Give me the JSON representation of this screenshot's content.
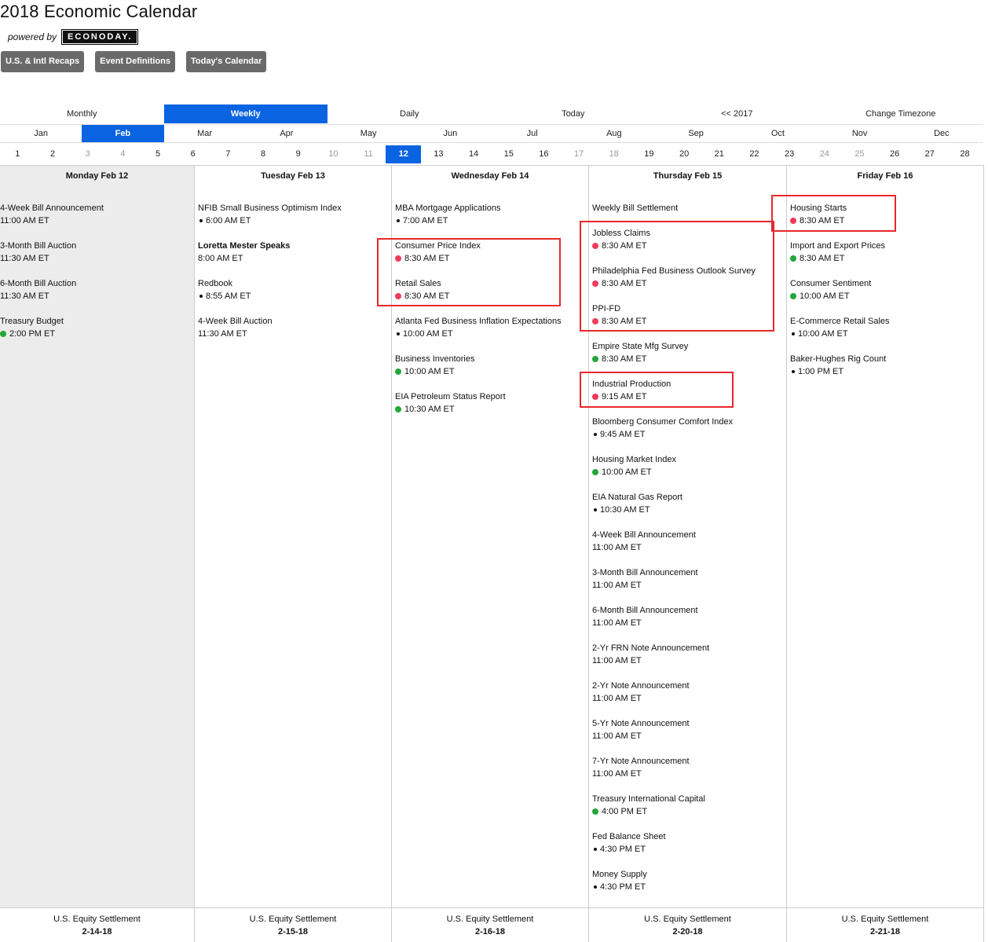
{
  "header": {
    "title": "2018 Economic Calendar",
    "powered_by": "powered by",
    "logo_text": "ECONODAY."
  },
  "buttons": [
    "U.S. & Intl Recaps",
    "Event Definitions",
    "Today's Calendar"
  ],
  "views": [
    "Monthly",
    "Weekly",
    "Daily",
    "Today",
    "<< 2017",
    "Change Timezone"
  ],
  "active_view": "Weekly",
  "months": [
    "Jan",
    "Feb",
    "Mar",
    "Apr",
    "May",
    "Jun",
    "Jul",
    "Aug",
    "Sep",
    "Oct",
    "Nov",
    "Dec"
  ],
  "active_month": "Feb",
  "days": [
    "1",
    "2",
    "3",
    "4",
    "5",
    "6",
    "7",
    "8",
    "9",
    "10",
    "11",
    "12",
    "13",
    "14",
    "15",
    "16",
    "17",
    "18",
    "19",
    "20",
    "21",
    "22",
    "23",
    "24",
    "25",
    "26",
    "27",
    "28"
  ],
  "weekend_days": [
    "3",
    "4",
    "10",
    "11",
    "17",
    "18",
    "24",
    "25"
  ],
  "active_day": "12",
  "columns": [
    {
      "header": "Monday Feb 12",
      "today": true,
      "events": [
        {
          "name": "4-Week Bill Announcement",
          "time": "11:00 AM ET",
          "dot": ""
        },
        {
          "name": "3-Month Bill Auction",
          "time": "11:30 AM ET",
          "dot": ""
        },
        {
          "name": "6-Month Bill Auction",
          "time": "11:30 AM ET",
          "dot": ""
        },
        {
          "name": "Treasury Budget",
          "time": "2:00 PM ET",
          "dot": "green"
        }
      ],
      "footer_label": "U.S. Equity Settlement",
      "footer_date": "2-14-18"
    },
    {
      "header": "Tuesday Feb 13",
      "today": false,
      "events": [
        {
          "name": "NFIB Small Business Optimism Index",
          "time": "6:00 AM ET",
          "dot": "black"
        },
        {
          "name": "Loretta Mester Speaks",
          "time": "8:00 AM ET",
          "dot": "",
          "bold": true
        },
        {
          "name": "Redbook",
          "time": "8:55 AM ET",
          "dot": "black"
        },
        {
          "name": "4-Week Bill Auction",
          "time": "11:30 AM ET",
          "dot": ""
        }
      ],
      "footer_label": "U.S. Equity Settlement",
      "footer_date": "2-15-18"
    },
    {
      "header": "Wednesday Feb 14",
      "today": false,
      "events": [
        {
          "name": "MBA Mortgage Applications",
          "time": "7:00 AM ET",
          "dot": "black"
        },
        {
          "name": "Consumer Price Index",
          "time": "8:30 AM ET",
          "dot": "red"
        },
        {
          "name": "Retail Sales",
          "time": "8:30 AM ET",
          "dot": "red"
        },
        {
          "name": "Atlanta Fed Business Inflation Expectations",
          "time": "10:00 AM ET",
          "dot": "black"
        },
        {
          "name": "Business Inventories",
          "time": "10:00 AM ET",
          "dot": "green"
        },
        {
          "name": "EIA Petroleum Status Report",
          "time": "10:30 AM ET",
          "dot": "green"
        }
      ],
      "footer_label": "U.S. Equity Settlement",
      "footer_date": "2-16-18"
    },
    {
      "header": "Thursday Feb 15",
      "today": false,
      "first_event_compact": true,
      "events": [
        {
          "name": "Weekly Bill Settlement",
          "time": "",
          "dot": ""
        },
        {
          "name": "Jobless Claims",
          "time": "8:30 AM ET",
          "dot": "red"
        },
        {
          "name": "Philadelphia Fed Business Outlook Survey",
          "time": "8:30 AM ET",
          "dot": "red"
        },
        {
          "name": "PPI-FD",
          "time": "8:30 AM ET",
          "dot": "red"
        },
        {
          "name": "Empire State Mfg Survey",
          "time": "8:30 AM ET",
          "dot": "green"
        },
        {
          "name": "Industrial Production",
          "time": "9:15 AM ET",
          "dot": "red"
        },
        {
          "name": "Bloomberg Consumer Comfort Index",
          "time": "9:45 AM ET",
          "dot": "black"
        },
        {
          "name": "Housing Market Index",
          "time": "10:00 AM ET",
          "dot": "green"
        },
        {
          "name": "EIA Natural Gas Report",
          "time": "10:30 AM ET",
          "dot": "black"
        },
        {
          "name": "4-Week Bill Announcement",
          "time": "11:00 AM ET",
          "dot": ""
        },
        {
          "name": "3-Month Bill Announcement",
          "time": "11:00 AM ET",
          "dot": ""
        },
        {
          "name": "6-Month Bill Announcement",
          "time": "11:00 AM ET",
          "dot": ""
        },
        {
          "name": "2-Yr FRN Note Announcement",
          "time": "11:00 AM ET",
          "dot": ""
        },
        {
          "name": "2-Yr Note Announcement",
          "time": "11:00 AM ET",
          "dot": ""
        },
        {
          "name": "5-Yr Note Announcement",
          "time": "11:00 AM ET",
          "dot": ""
        },
        {
          "name": "7-Yr Note Announcement",
          "time": "11:00 AM ET",
          "dot": ""
        },
        {
          "name": "Treasury International Capital",
          "time": "4:00 PM ET",
          "dot": "green"
        },
        {
          "name": "Fed Balance Sheet",
          "time": "4:30 PM ET",
          "dot": "black"
        },
        {
          "name": "Money Supply",
          "time": "4:30 PM ET",
          "dot": "black"
        }
      ],
      "footer_label": "U.S. Equity Settlement",
      "footer_date": "2-20-18"
    },
    {
      "header": "Friday Feb 16",
      "today": false,
      "events": [
        {
          "name": "Housing Starts",
          "time": "8:30 AM ET",
          "dot": "red"
        },
        {
          "name": "Import and Export Prices",
          "time": "8:30 AM ET",
          "dot": "green"
        },
        {
          "name": "Consumer Sentiment",
          "time": "10:00 AM ET",
          "dot": "green"
        },
        {
          "name": "E-Commerce Retail Sales",
          "time": "10:00 AM ET",
          "dot": "black"
        },
        {
          "name": "Baker-Hughes Rig Count",
          "time": "1:00 PM ET",
          "dot": "black"
        }
      ],
      "footer_label": "U.S. Equity Settlement",
      "footer_date": "2-21-18"
    }
  ],
  "colors": {
    "accent": "#0a63e0",
    "button_gray": "#6a6a6a",
    "dot_red": "#f03c5a",
    "dot_green": "#22a83a",
    "highlight": "#e8282d",
    "today_bg": "#ececec"
  }
}
